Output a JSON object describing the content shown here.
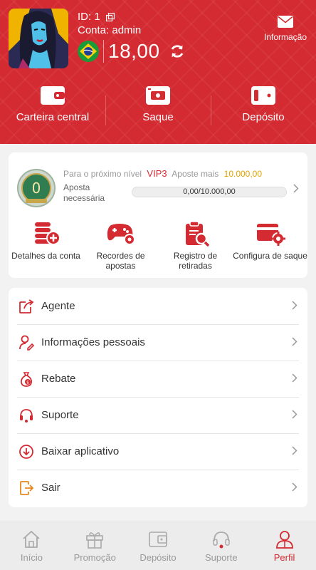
{
  "profile": {
    "id_label": "ID: 1",
    "account_label": "Conta: admin",
    "balance": "18,00"
  },
  "header": {
    "info_label": "Informação",
    "actions": [
      {
        "label": "Carteira central",
        "icon": "wallet-icon"
      },
      {
        "label": "Saque",
        "icon": "cash-icon"
      },
      {
        "label": "Depósito",
        "icon": "deposit-wallet-icon"
      }
    ]
  },
  "vip": {
    "badge_level": "0",
    "next_level_text": "Para o próximo nível",
    "next_level": "VIP3",
    "bet_more_text": "Aposte mais",
    "bet_more_amount": "10.000,00",
    "required_label": "Aposta necessária",
    "progress_text": "0,00/10.000,00",
    "progress_fraction": 0
  },
  "quick_actions": [
    {
      "label": "Detalhes da conta",
      "icon": "account-details-icon"
    },
    {
      "label": "Recordes de apostas",
      "icon": "gamepad-icon"
    },
    {
      "label": "Registro de retiradas",
      "icon": "withdrawal-record-icon"
    },
    {
      "label": "Configura de saque",
      "icon": "withdraw-settings-icon"
    }
  ],
  "menu": [
    {
      "label": "Agente",
      "icon": "share-icon"
    },
    {
      "label": "Informações pessoais",
      "icon": "user-edit-icon"
    },
    {
      "label": "Rebate",
      "icon": "money-bag-icon"
    },
    {
      "label": "Suporte",
      "icon": "headset-icon"
    },
    {
      "label": "Baixar aplicativo",
      "icon": "download-icon"
    },
    {
      "label": "Sair",
      "icon": "logout-icon"
    }
  ],
  "bottom_nav": [
    {
      "label": "Início",
      "icon": "home-icon"
    },
    {
      "label": "Promoção",
      "icon": "gift-icon"
    },
    {
      "label": "Depósito",
      "icon": "deposit-icon"
    },
    {
      "label": "Suporte",
      "icon": "support-icon"
    },
    {
      "label": "Perfil",
      "icon": "profile-icon",
      "active": true
    }
  ],
  "colors": {
    "brand_red": "#d42a31",
    "gold": "#e0a300",
    "badge_green": "#2f7d50"
  }
}
